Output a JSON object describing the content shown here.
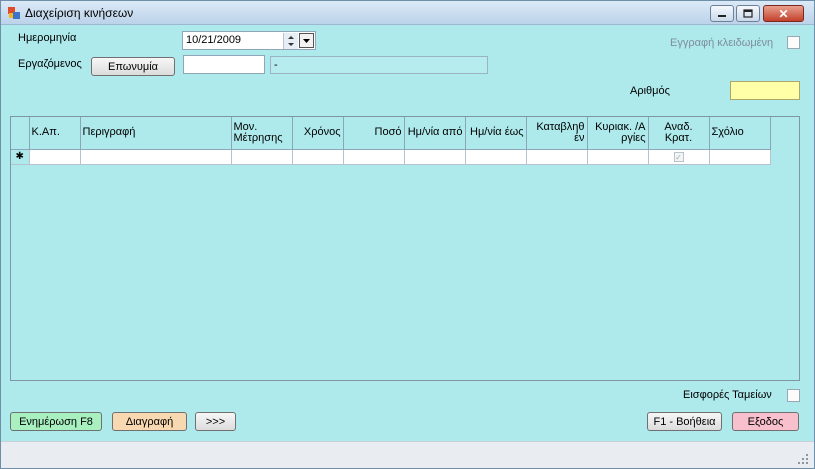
{
  "window": {
    "title": "Διαχείριση κινήσεων"
  },
  "form": {
    "date_label": "Ημερομηνία",
    "date_value": "10/21/2009",
    "employee_label": "Εργαζόμενος",
    "name_button": "Επωνυμία",
    "employee_code": "",
    "employee_name": "-",
    "locked_label": "Εγγραφή κλειδωμένη",
    "number_label": "Αριθμός",
    "number_value": ""
  },
  "grid": {
    "new_row_marker": "✱",
    "columns": [
      {
        "label": "Κ.Απ.",
        "align": "left"
      },
      {
        "label": "Περιγραφή",
        "align": "left"
      },
      {
        "label": "Μον. Μέτρησης",
        "align": "left"
      },
      {
        "label": "Χρόνος",
        "align": "right"
      },
      {
        "label": "Ποσό",
        "align": "right"
      },
      {
        "label": "Ημ/νία από",
        "align": "right"
      },
      {
        "label": "Ημ/νία έως",
        "align": "right"
      },
      {
        "label": "Καταβληθ έν",
        "align": "right"
      },
      {
        "label": "Κυριακ. /Α ργίες",
        "align": "right"
      },
      {
        "label": "Αναδ. Κρατ.",
        "align": "center"
      },
      {
        "label": "Σχόλιο",
        "align": "left"
      }
    ]
  },
  "footer": {
    "funds_label": "Εισφορές Ταμείων",
    "update_button": "Ενημέρωση F8",
    "delete_button": "Διαγραφή",
    "more_button": ">>>",
    "help_button": "F1 - Βοήθεια",
    "exit_button": "Εξοδος"
  },
  "colors": {
    "window_background": "#aee9ec",
    "number_field": "#ffffa8",
    "update_button": "#a8f0c0",
    "delete_button": "#f8d8b0",
    "exit_button": "#f8c0cc"
  }
}
